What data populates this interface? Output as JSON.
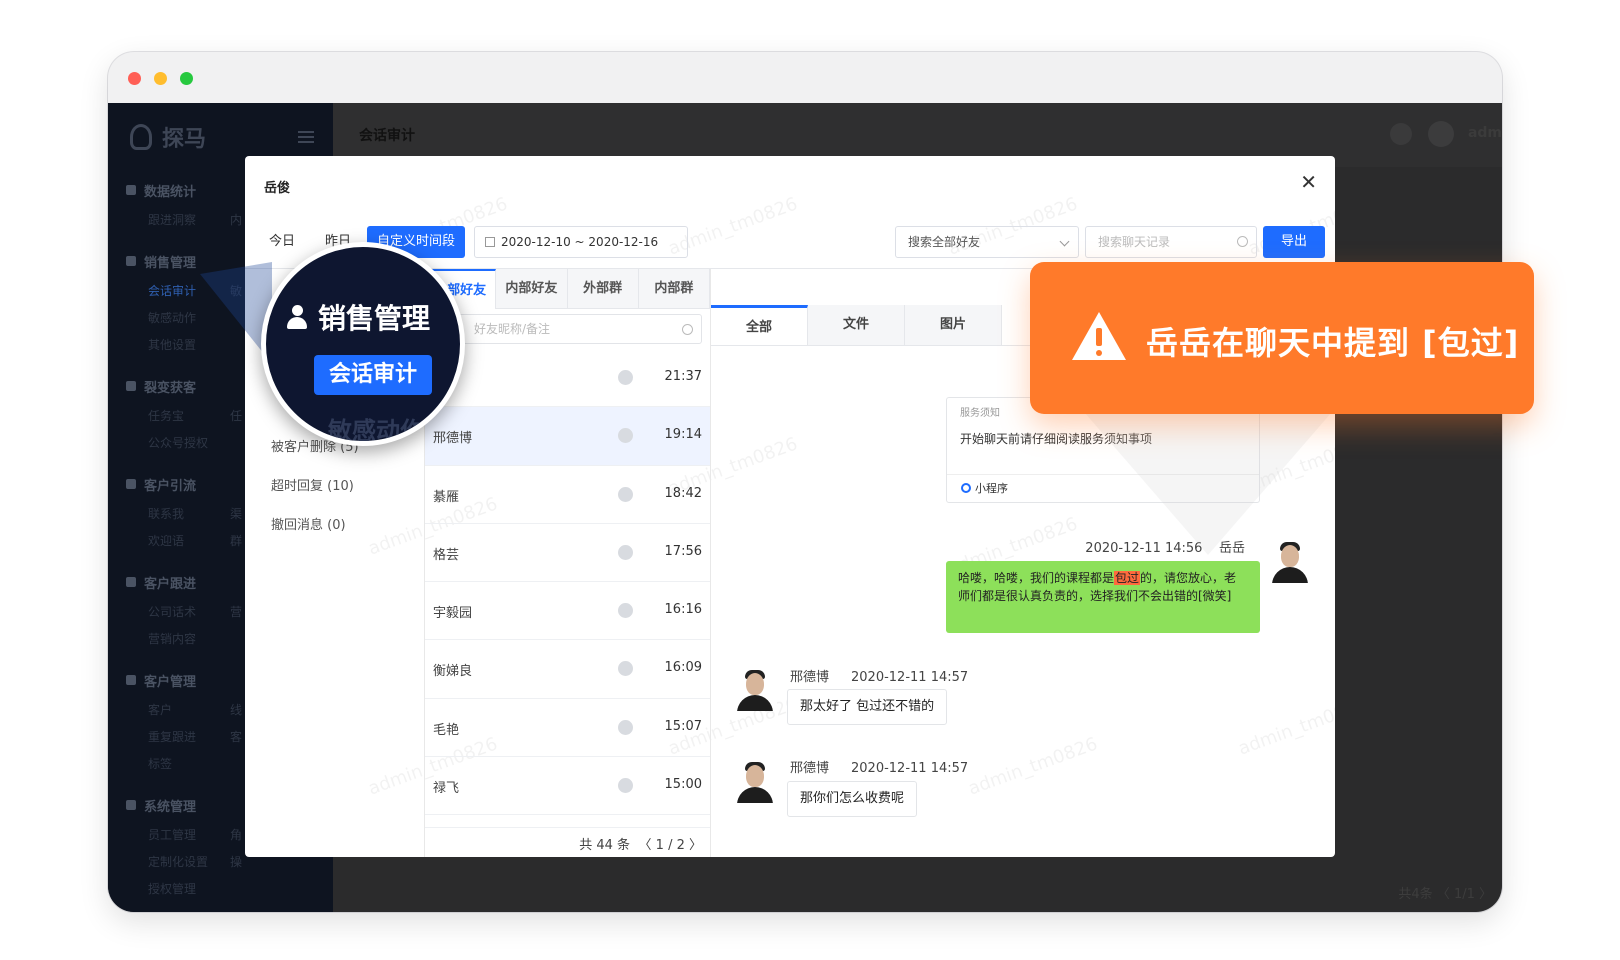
{
  "sidebar": {
    "brand": "探马",
    "groups": [
      {
        "title": "数据统计",
        "items": [
          {
            "label": "跟进洞察",
            "sub": "内"
          }
        ]
      },
      {
        "title": "销售管理",
        "items": [
          {
            "label": "会话审计",
            "sub": "敏"
          },
          {
            "label": "敏感动作",
            "sub": ""
          },
          {
            "label": "其他设置",
            "sub": ""
          }
        ]
      },
      {
        "title": "裂变获客",
        "items": [
          {
            "label": "任务宝",
            "sub": "任"
          },
          {
            "label": "公众号授权",
            "sub": ""
          }
        ]
      },
      {
        "title": "客户引流",
        "items": [
          {
            "label": "联系我",
            "sub": "渠"
          },
          {
            "label": "欢迎语",
            "sub": "群"
          }
        ]
      },
      {
        "title": "客户跟进",
        "items": [
          {
            "label": "公司话术",
            "sub": "营"
          },
          {
            "label": "营销内容",
            "sub": ""
          }
        ]
      },
      {
        "title": "客户管理",
        "items": [
          {
            "label": "客户",
            "sub": "线"
          },
          {
            "label": "重复跟进",
            "sub": "客"
          },
          {
            "label": "标签",
            "sub": ""
          }
        ]
      },
      {
        "title": "系统管理",
        "items": [
          {
            "label": "员工管理",
            "sub": "角"
          },
          {
            "label": "定制化设置",
            "sub": "操"
          },
          {
            "label": "授权管理",
            "sub": ""
          }
        ]
      }
    ]
  },
  "topbar": {
    "title": "会话审计",
    "user": "adm"
  },
  "bg_pager": "共4条 〈 1/1 〉",
  "modal": {
    "title": "岳俊",
    "toolbar": {
      "today": "今日",
      "yesterday": "昨日",
      "custom": "自定义时间段",
      "date_range": "2020-12-10 ~ 2020-12-16",
      "friends_select": "搜索全部好友",
      "search_placeholder": "搜索聊天记录",
      "export": "导出"
    },
    "categories": [
      {
        "label": "被客户删除 (5)"
      },
      {
        "label": "超时回复 (10)"
      },
      {
        "label": "撤回消息 (0)"
      }
    ],
    "contact_tabs": [
      "外部好友",
      "内部好友",
      "外部群",
      "内部群"
    ],
    "contact_search": "好友昵称/备注",
    "contacts": [
      {
        "name": "",
        "time": "21:37"
      },
      {
        "name": "邢德博",
        "time": "19:14"
      },
      {
        "name": "綦雁",
        "time": "18:42"
      },
      {
        "name": "格芸",
        "time": "17:56"
      },
      {
        "name": "宇毅园",
        "time": "16:16"
      },
      {
        "name": "衡娣良",
        "time": "16:09"
      },
      {
        "name": "毛艳",
        "time": "15:07"
      },
      {
        "name": "禄飞",
        "time": "15:00"
      }
    ],
    "contact_footer": {
      "total": "共 44 条",
      "pages": "〈 1 / 2 〉"
    },
    "chat_tabs": [
      "全部",
      "文件",
      "图片"
    ],
    "mini_card": {
      "label": "服务须知",
      "text": "开始聊天前请仔细阅读服务须知事项",
      "footer": "小程序"
    },
    "messages": [
      {
        "time": "2020-12-11 14:56",
        "name": "岳岳",
        "before": "哈喽，哈喽，我们的课程都是",
        "keyword": "包过",
        "after": "的，请您放心，老师们都是很认真负责的，选择我们不会出错的[微笑]"
      },
      {
        "name": "邢德博",
        "time": "2020-12-11 14:57",
        "text": "那太好了 包过还不错的"
      },
      {
        "name": "邢德博",
        "time": "2020-12-11 14:57",
        "text": "那你们怎么收费呢"
      }
    ],
    "watermark": "admin_tm0826"
  },
  "magnifier": {
    "title": "销售管理",
    "button": "会话审计",
    "ghost": "敏感动作"
  },
  "alert": {
    "text": "岳岳在聊天中提到 [包过]"
  },
  "colors": {
    "primary": "#1e6cff",
    "alert": "#ff7a2a",
    "bubble_green": "#8de05a",
    "keyword": "#ff6a3d",
    "sidebar": "#0e1420"
  }
}
